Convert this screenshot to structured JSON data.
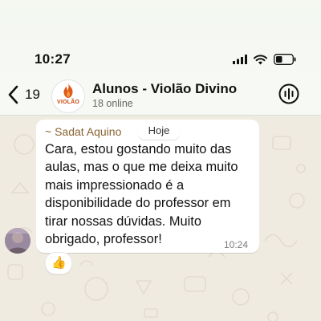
{
  "status_bar": {
    "time": "10:27",
    "icons": [
      "signal-icon",
      "wifi-icon",
      "battery-icon"
    ]
  },
  "chat_header": {
    "back_count": "19",
    "group_name": "Alunos - Violão Divino",
    "subtitle": "18 online",
    "avatar_text": "VIOLÃO",
    "avatar_icon": "flame-icon",
    "action_icon": "audio-call-icon"
  },
  "message": {
    "sender": "~ Sadat Aquino",
    "date_label": "Hoje",
    "text": "Cara, estou gostando muito das aulas, mas o que me deixa muito mais impressionado é a disponibilidade do professor em tirar nossas dúvidas. Muito obrigado, professor!",
    "time": "10:24",
    "reaction": "👍"
  },
  "colors": {
    "header_bg": "#f5f8f2",
    "wallpaper": "#f0ebe1",
    "bubble": "#ffffff",
    "sender": "#8a6332",
    "brand": "#c64b12"
  }
}
